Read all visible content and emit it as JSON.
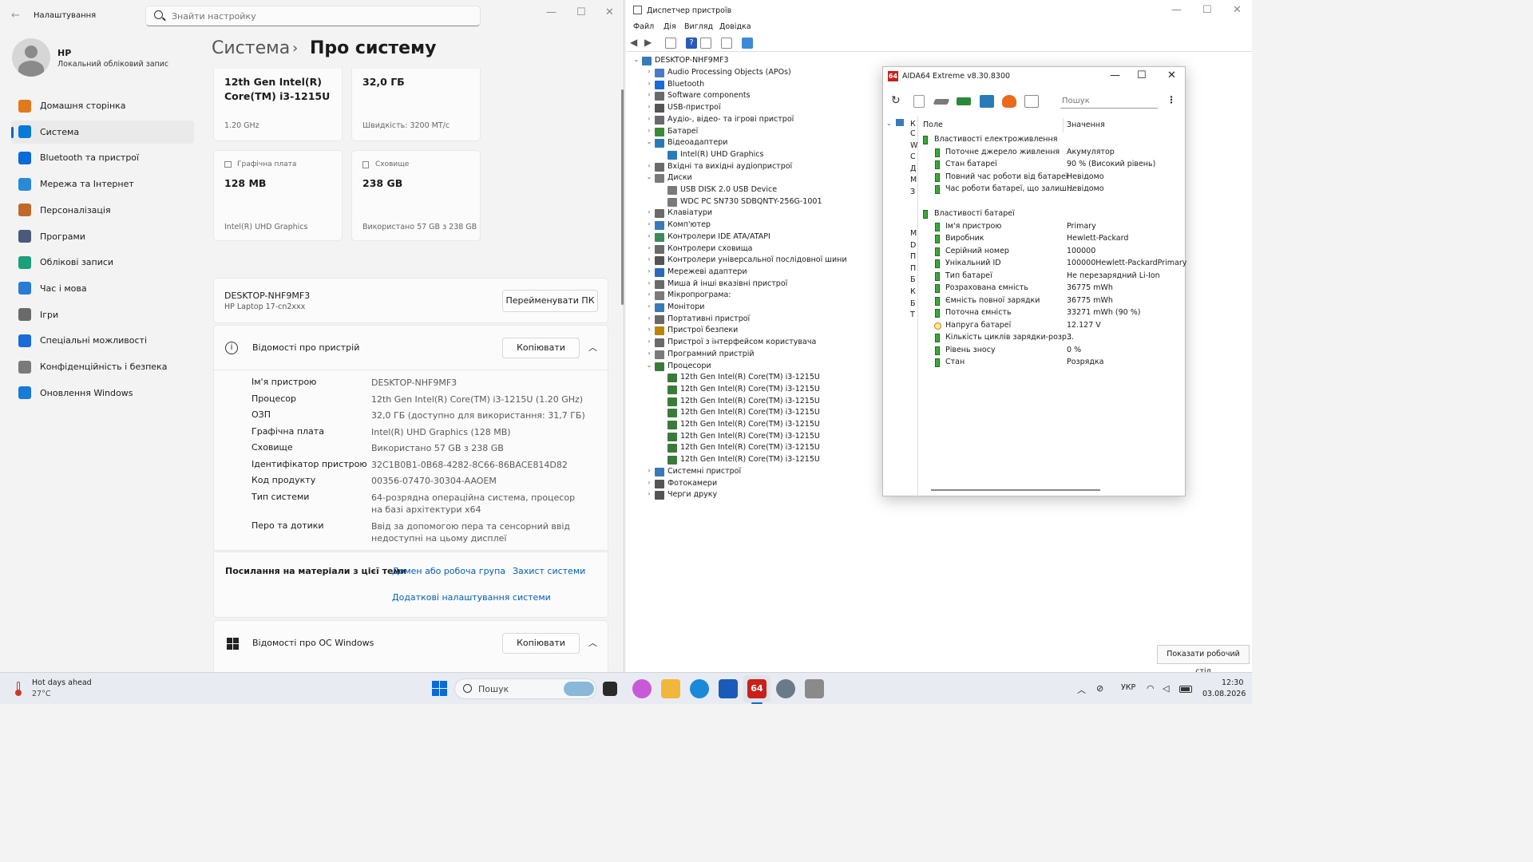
{
  "settings": {
    "title": "Налаштування",
    "search_placeholder": "Знайти настройку",
    "user": {
      "name": "HP",
      "sub": "Локальний обліковий запис"
    },
    "nav": [
      {
        "label": "Домашня сторінка",
        "color": "#e07a1c"
      },
      {
        "label": "Система",
        "color": "#0a7ad8"
      },
      {
        "label": "Bluetooth та пристрої",
        "color": "#0a6ad8"
      },
      {
        "label": "Мережа та Інтернет",
        "color": "#2a8ad8"
      },
      {
        "label": "Персоналізація",
        "color": "#c06a2a"
      },
      {
        "label": "Програми",
        "color": "#4a5a7a"
      },
      {
        "label": "Облікові записи",
        "color": "#1aa07a"
      },
      {
        "label": "Час і мова",
        "color": "#2a7ad8"
      },
      {
        "label": "Ігри",
        "color": "#6a6a6a"
      },
      {
        "label": "Спеціальні можливості",
        "color": "#1a6ad8"
      },
      {
        "label": "Конфіденційність і безпека",
        "color": "#7a7a7a"
      },
      {
        "label": "Оновлення Windows",
        "color": "#1a7ad8"
      }
    ],
    "breadcrumb_parent": "Система",
    "breadcrumb_sep": "›",
    "breadcrumb_current": "Про систему",
    "specs": {
      "cpu_name": "12th Gen Intel(R) Core(TM) i3-1215U",
      "cpu_sub": "1.20 GHz",
      "ram": "32,0 ГБ",
      "ram_sub": "Швидкість: 3200 MT/с",
      "gpu_label": "Графічна плата",
      "gpu": "128 MB",
      "gpu_sub": "Intel(R) UHD Graphics",
      "storage_label": "Сховище",
      "storage": "238 GB",
      "storage_sub": "Використано 57 GB з 238 GB"
    },
    "device": {
      "name": "DESKTOP-NHF9MF3",
      "model": "HP Laptop 17-cn2xxx",
      "rename_btn": "Перейменувати ПК"
    },
    "device_info": {
      "title": "Відомості про пристрій",
      "copy_btn": "Копіювати",
      "rows": [
        {
          "k": "Ім'я пристрою",
          "v": "DESKTOP-NHF9MF3"
        },
        {
          "k": "Процесор",
          "v": "12th Gen Intel(R) Core(TM) i3-1215U (1.20 GHz)"
        },
        {
          "k": "ОЗП",
          "v": "32,0 ГБ (доступно для використання: 31,7 ГБ)"
        },
        {
          "k": "Графічна плата",
          "v": "Intel(R) UHD Graphics (128 MB)"
        },
        {
          "k": "Сховище",
          "v": "Використано 57 GB з 238 GB"
        },
        {
          "k": "Ідентифікатор пристрою",
          "v": "32C1B0B1-0B68-4282-8C66-86BACE814D82"
        },
        {
          "k": "Код продукту",
          "v": "00356-07470-30304-AAOEM"
        },
        {
          "k": "Тип системи",
          "v": "64-розрядна операційна система, процесор на базі архітектури x64"
        },
        {
          "k": "Перо та дотики",
          "v": "Ввід за допомогою пера та сенсорний ввід недоступні на цьому дисплеї"
        }
      ]
    },
    "links": {
      "label": "Посилання на матеріали з цієї теми",
      "l1": "Домен або робоча група",
      "l2": "Захист системи",
      "l3": "Додаткові налаштування системи"
    },
    "windows_info": {
      "title": "Відомості про ОС Windows",
      "copy_btn": "Копіювати"
    }
  },
  "devmgr": {
    "title": "Диспетчер пристроїв",
    "menu": [
      "Файл",
      "Дія",
      "Вигляд",
      "Довідка"
    ],
    "root": "DESKTOP-NHF9MF3",
    "items": [
      {
        "label": "Audio Processing Objects (APOs)",
        "lvl": 1,
        "tw": "›",
        "color": "#4a7ac8"
      },
      {
        "label": "Bluetooth",
        "lvl": 1,
        "tw": "›",
        "color": "#1a6ad8"
      },
      {
        "label": "Software components",
        "lvl": 1,
        "tw": "›",
        "color": "#6a6a6a"
      },
      {
        "label": "USB-пристрої",
        "lvl": 1,
        "tw": "›",
        "color": "#555555"
      },
      {
        "label": "Аудіо-, відео- та ігрові пристрої",
        "lvl": 1,
        "tw": "›",
        "color": "#6a6a6a"
      },
      {
        "label": "Батареї",
        "lvl": 1,
        "tw": "›",
        "color": "#3a8a3a"
      },
      {
        "label": "Відеоадаптери",
        "lvl": 1,
        "tw": "⌄",
        "color": "#2a7ab8"
      },
      {
        "label": "Intel(R) UHD Graphics",
        "lvl": 2,
        "tw": "",
        "color": "#2a7ab8"
      },
      {
        "label": "Вхідні та вихідні аудіопристрої",
        "lvl": 1,
        "tw": "›",
        "color": "#6a6a6a"
      },
      {
        "label": "Диски",
        "lvl": 1,
        "tw": "⌄",
        "color": "#7a7a7a"
      },
      {
        "label": "USB DISK 2.0 USB Device",
        "lvl": 2,
        "tw": "",
        "color": "#7a7a7a"
      },
      {
        "label": "WDC PC SN730 SDBQNTY-256G-1001",
        "lvl": 2,
        "tw": "",
        "color": "#7a7a7a"
      },
      {
        "label": "Клавіатури",
        "lvl": 1,
        "tw": "›",
        "color": "#6a6a6a"
      },
      {
        "label": "Комп'ютер",
        "lvl": 1,
        "tw": "›",
        "color": "#3a7ab8"
      },
      {
        "label": "Контролери IDE ATA/ATAPI",
        "lvl": 1,
        "tw": "›",
        "color": "#3a8a5a"
      },
      {
        "label": "Контролери сховища",
        "lvl": 1,
        "tw": "›",
        "color": "#6a6a6a"
      },
      {
        "label": "Контролери універсальної послідовної шини",
        "lvl": 1,
        "tw": "›",
        "color": "#555555"
      },
      {
        "label": "Мережеві адаптери",
        "lvl": 1,
        "tw": "›",
        "color": "#2a6ab8"
      },
      {
        "label": "Миша й інші вказівні пристрої",
        "lvl": 1,
        "tw": "›",
        "color": "#6a6a6a"
      },
      {
        "label": "Мікропрограма:",
        "lvl": 1,
        "tw": "›",
        "color": "#7a7a7a"
      },
      {
        "label": "Монітори",
        "lvl": 1,
        "tw": "›",
        "color": "#3a7ab8"
      },
      {
        "label": "Портативні пристрої",
        "lvl": 1,
        "tw": "›",
        "color": "#6a6a6a"
      },
      {
        "label": "Пристрої безпеки",
        "lvl": 1,
        "tw": "›",
        "color": "#b8860b"
      },
      {
        "label": "Пристрої з інтерфейсом користувача",
        "lvl": 1,
        "tw": "›",
        "color": "#6a6a6a"
      },
      {
        "label": "Програмний пристрій",
        "lvl": 1,
        "tw": "›",
        "color": "#7a7a7a"
      },
      {
        "label": "Процесори",
        "lvl": 1,
        "tw": "⌄",
        "color": "#3a7a3a"
      },
      {
        "label": "12th Gen Intel(R) Core(TM) i3-1215U",
        "lvl": 2,
        "tw": "",
        "color": "#3a7a3a"
      },
      {
        "label": "12th Gen Intel(R) Core(TM) i3-1215U",
        "lvl": 2,
        "tw": "",
        "color": "#3a7a3a"
      },
      {
        "label": "12th Gen Intel(R) Core(TM) i3-1215U",
        "lvl": 2,
        "tw": "",
        "color": "#3a7a3a"
      },
      {
        "label": "12th Gen Intel(R) Core(TM) i3-1215U",
        "lvl": 2,
        "tw": "",
        "color": "#3a7a3a"
      },
      {
        "label": "12th Gen Intel(R) Core(TM) i3-1215U",
        "lvl": 2,
        "tw": "",
        "color": "#3a7a3a"
      },
      {
        "label": "12th Gen Intel(R) Core(TM) i3-1215U",
        "lvl": 2,
        "tw": "",
        "color": "#3a7a3a"
      },
      {
        "label": "12th Gen Intel(R) Core(TM) i3-1215U",
        "lvl": 2,
        "tw": "",
        "color": "#3a7a3a"
      },
      {
        "label": "12th Gen Intel(R) Core(TM) i3-1215U",
        "lvl": 2,
        "tw": "",
        "color": "#3a7a3a"
      },
      {
        "label": "Системні пристрої",
        "lvl": 1,
        "tw": "›",
        "color": "#3a7ab8"
      },
      {
        "label": "Фотокамери",
        "lvl": 1,
        "tw": "›",
        "color": "#555555"
      },
      {
        "label": "Черги друку",
        "lvl": 1,
        "tw": "›",
        "color": "#555555"
      }
    ]
  },
  "aida": {
    "title": "AIDA64 Extreme v8.30.8300",
    "logo": "64",
    "search_placeholder": "Пошук",
    "col_field": "Поле",
    "col_value": "Значення",
    "left_letters": [
      "К",
      "С",
      "W",
      "С",
      "Д",
      "М",
      "З",
      "М",
      "D",
      "П",
      "П",
      "Б",
      "К",
      "Б",
      "Т"
    ],
    "sections": [
      {
        "title": "Властивості електроживлення",
        "rows": [
          {
            "k": "Поточне джерело живлення",
            "v": "Акумулятор"
          },
          {
            "k": "Стан батареї",
            "v": "90 % (Високий рівень)"
          },
          {
            "k": "Повний час роботи від батареї",
            "v": "Невідомо"
          },
          {
            "k": "Час роботи батареї, що залиш...",
            "v": "Невідомо"
          }
        ]
      },
      {
        "title": "Властивості батареї",
        "rows": [
          {
            "k": "Ім'я пристрою",
            "v": "Primary"
          },
          {
            "k": "Виробник",
            "v": "Hewlett-Packard"
          },
          {
            "k": "Серійний номер",
            "v": "100000"
          },
          {
            "k": "Унікальний ID",
            "v": "100000Hewlett-PackardPrimary"
          },
          {
            "k": "Тип батареї",
            "v": "Не перезарядний Li-Ion"
          },
          {
            "k": "Розрахована ємність",
            "v": "36775 mWh"
          },
          {
            "k": "Ємність повної зарядки",
            "v": "36775 mWh"
          },
          {
            "k": "Поточна ємність",
            "v": "33271 mWh  (90 %)"
          },
          {
            "k": "Напруга батареї",
            "v": "12.127 V",
            "icon": "bolt"
          },
          {
            "k": "Кількість циклів зарядки-розр...",
            "v": "3"
          },
          {
            "k": "Рівень зносу",
            "v": "0 %"
          },
          {
            "k": "Стан",
            "v": "Розрядка"
          }
        ]
      }
    ]
  },
  "taskbar": {
    "weather_title": "Hot days ahead",
    "weather_temp": "27°C",
    "search": "Пошук",
    "lang": "УКР",
    "time": "12:30",
    "date": "03.08.2026",
    "tooltip": "Показати робочий стіл"
  }
}
